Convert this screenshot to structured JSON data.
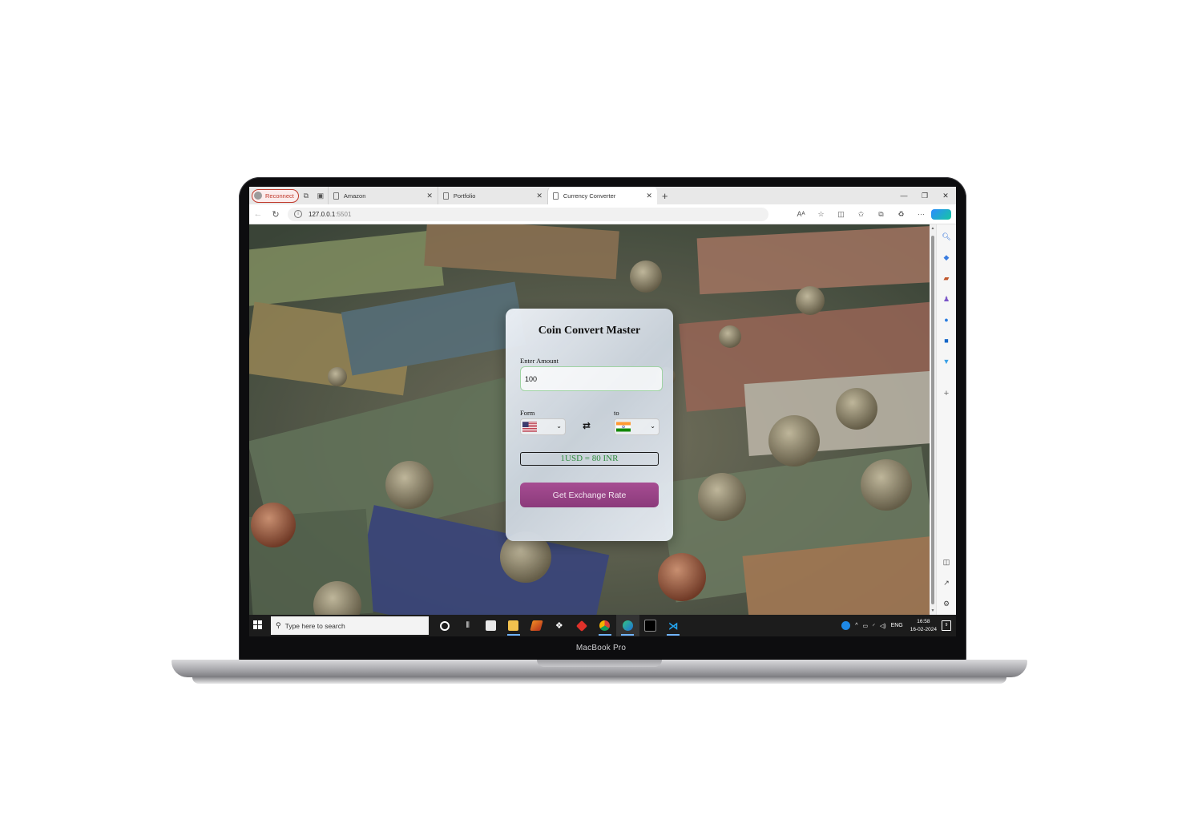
{
  "device": {
    "label": "MacBook Pro"
  },
  "browser": {
    "profile_button": "Reconnect",
    "tabs": [
      {
        "title": "Amazon",
        "active": false
      },
      {
        "title": "Portfolio",
        "active": false
      },
      {
        "title": "Currency Converter",
        "active": true
      }
    ],
    "close_glyph": "✕",
    "new_tab_glyph": "+",
    "window_controls": {
      "minimize": "—",
      "restore": "❐",
      "close": "✕"
    },
    "address": {
      "host": "127.0.0.1",
      "port": ":5501"
    },
    "icons": [
      "back-icon",
      "refresh-icon",
      "read-aloud-icon",
      "favorite-star-icon",
      "split-screen-icon",
      "favorites-icon",
      "collections-icon",
      "extensions-icon",
      "more-icon",
      "copilot-icon"
    ]
  },
  "app": {
    "title": "Coin Convert Master",
    "amount_label": "Enter Amount",
    "amount_value": "100",
    "from_label": "Form",
    "to_label": "to",
    "from_currency_flag": "US",
    "to_currency_flag": "IN",
    "swap_glyph": "⇄",
    "result_text": "1USD = 80 INR",
    "button_label": "Get Exchange Rate",
    "colors": {
      "button": "#9a4489",
      "result_text": "#2e8b3d",
      "input_border": "#9fd3a3"
    }
  },
  "taskbar": {
    "search_placeholder": "Type here to search",
    "language": "ENG",
    "time": "16:58",
    "date": "16-02-2024",
    "notification_count": "9"
  }
}
